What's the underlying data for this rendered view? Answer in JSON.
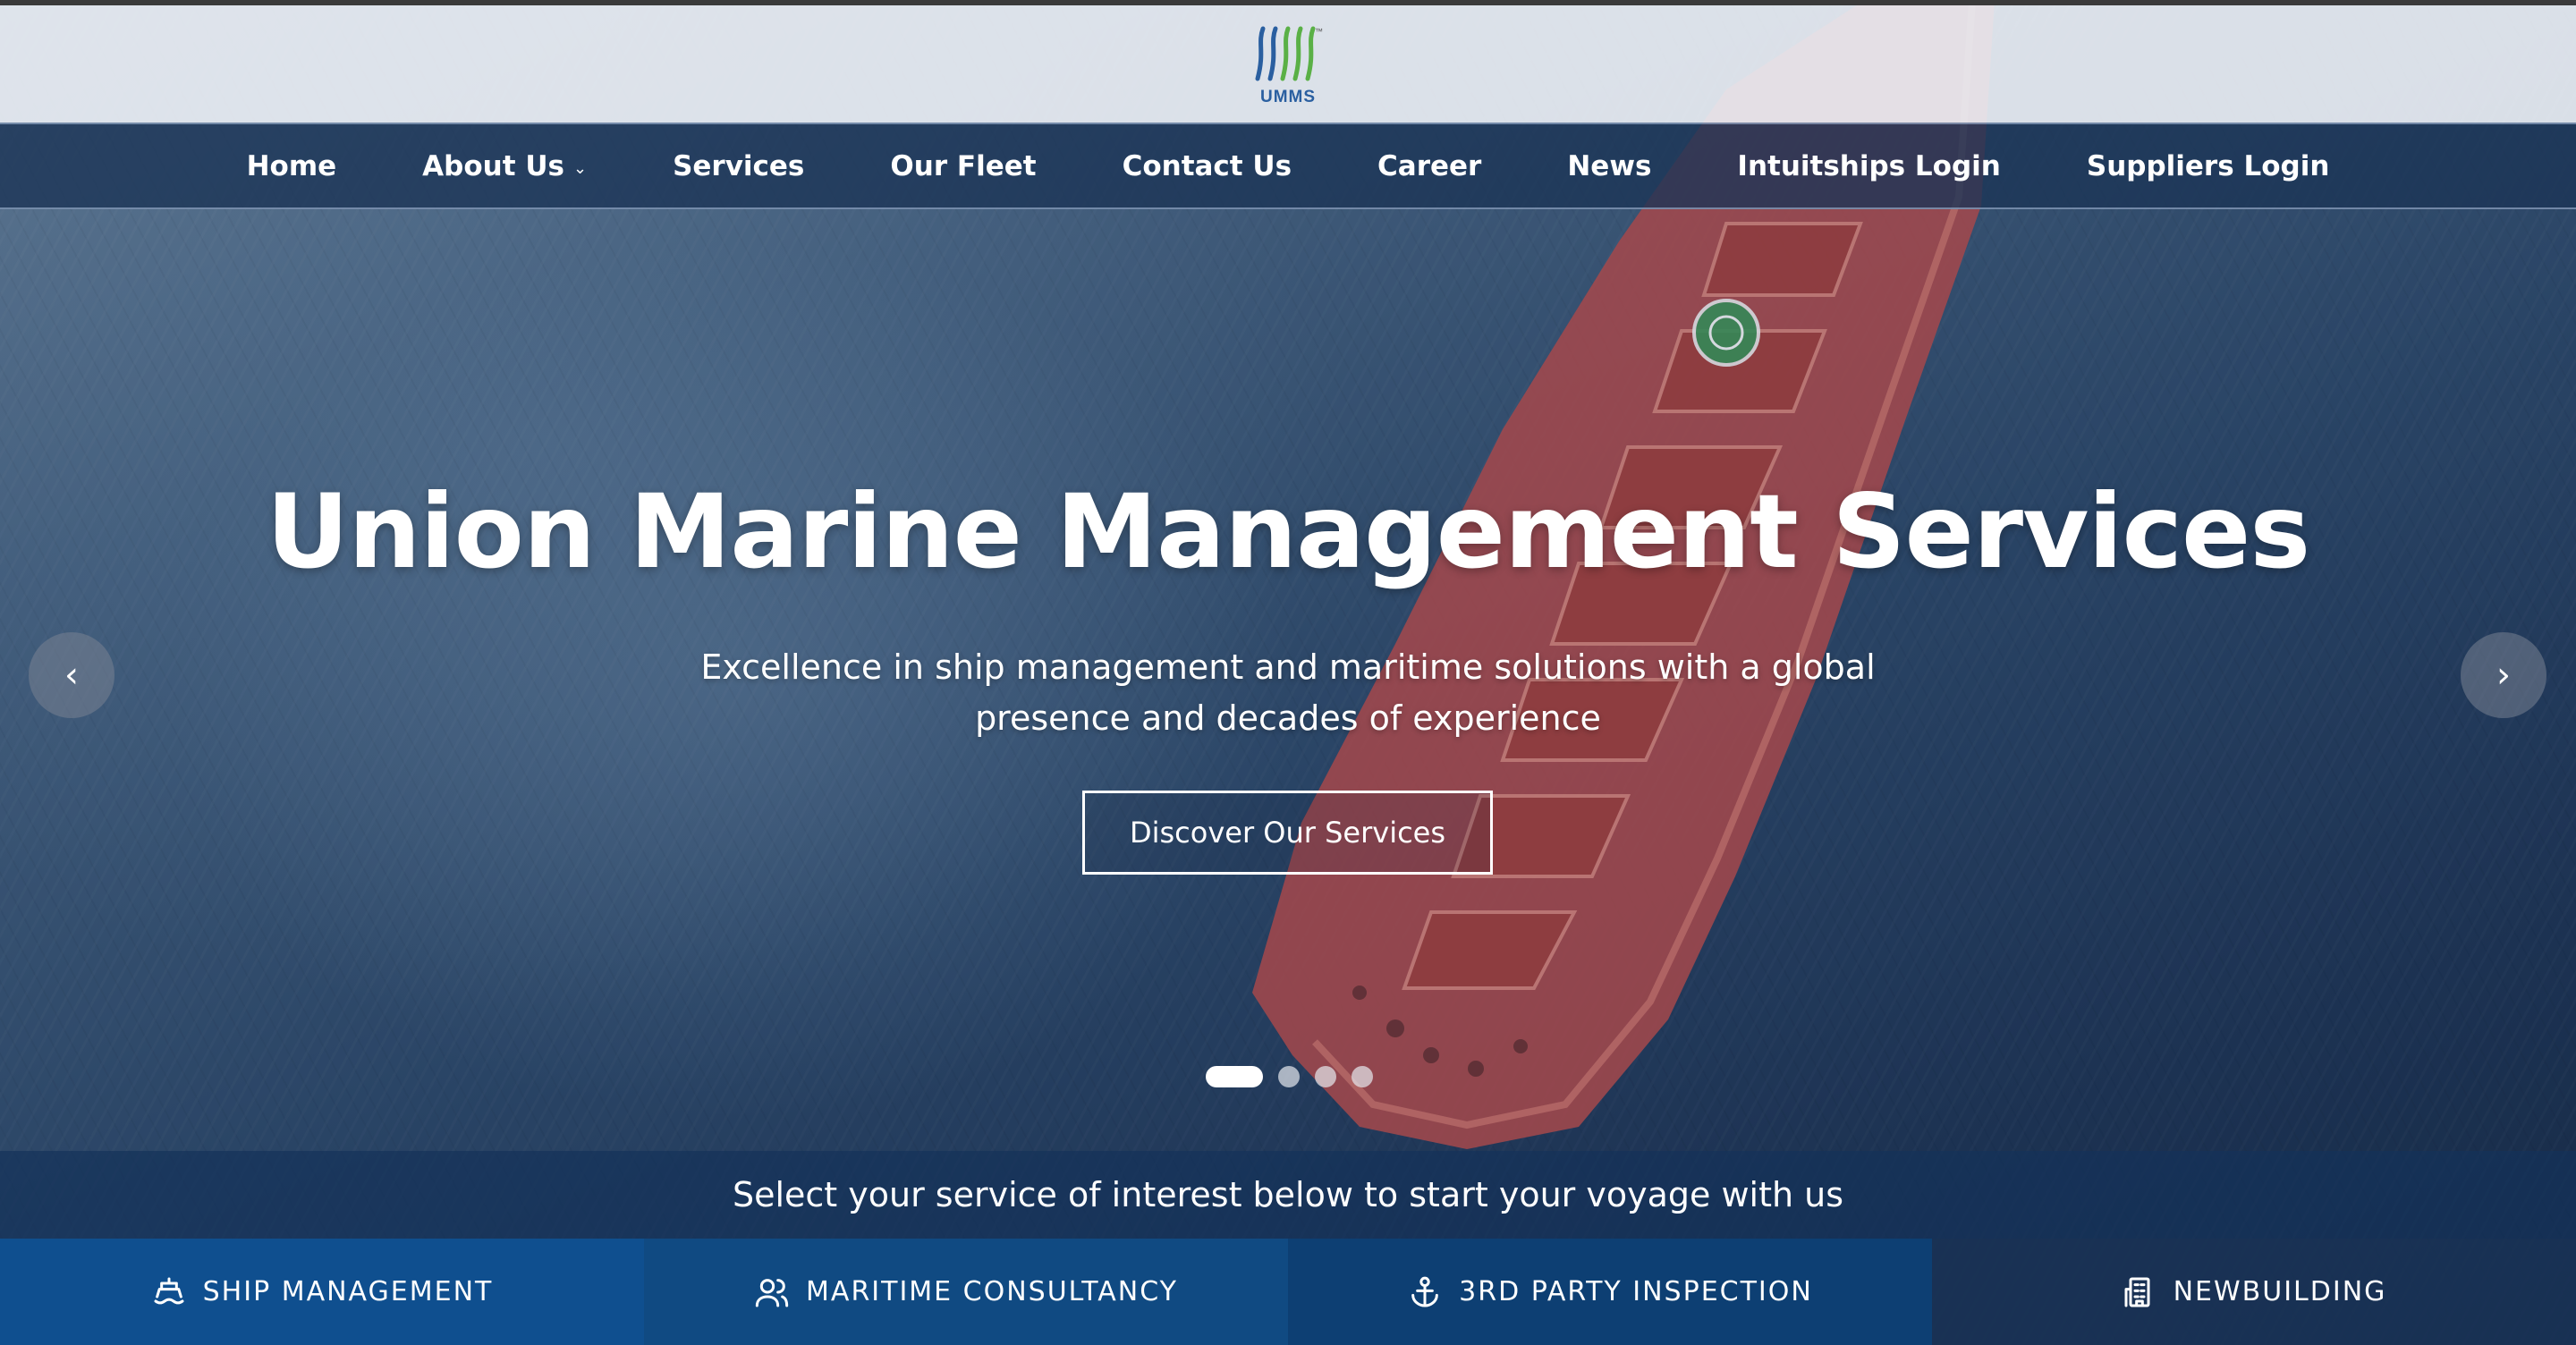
{
  "logo": {
    "text": "UMMS",
    "tm": "™"
  },
  "nav": {
    "items": [
      {
        "label": "Home"
      },
      {
        "label": "About Us",
        "has_dropdown": true
      },
      {
        "label": "Services"
      },
      {
        "label": "Our Fleet"
      },
      {
        "label": "Contact Us"
      },
      {
        "label": "Career"
      },
      {
        "label": "News"
      },
      {
        "label": "Intuitships Login"
      },
      {
        "label": "Suppliers Login"
      }
    ],
    "dropdown_icon": "chevron-down-icon"
  },
  "hero": {
    "title": "Union Marine Management Services",
    "subtitle_line1": "Excellence in ship management and maritime solutions with a global",
    "subtitle_line2": "presence and decades of experience",
    "cta_label": "Discover Our Services",
    "prev_icon": "‹",
    "next_icon": "›",
    "slides_count": 4,
    "active_slide": 1
  },
  "services": {
    "prompt": "Select your service of interest below to start your voyage with us",
    "tabs": [
      {
        "label": "SHIP MANAGEMENT",
        "icon": "ship-icon"
      },
      {
        "label": "MARITIME CONSULTANCY",
        "icon": "users-icon"
      },
      {
        "label": "3RD PARTY INSPECTION",
        "icon": "anchor-icon"
      },
      {
        "label": "NEWBUILDING",
        "icon": "building-icon"
      }
    ]
  },
  "colors": {
    "nav_bg": "#1c3456",
    "tab_active": "#0f4f8f",
    "ship_hull": "#c0504d",
    "logo_blue": "#2a5fa0",
    "logo_green": "#5ab046"
  }
}
